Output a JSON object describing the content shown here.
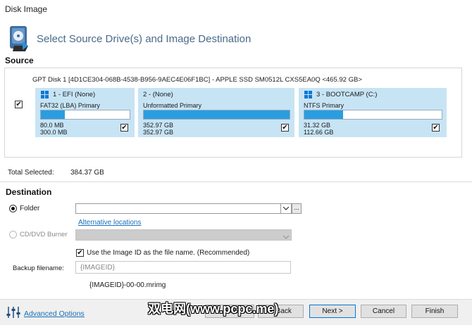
{
  "window": {
    "title": "Disk Image"
  },
  "header": {
    "title": "Select Source Drive(s) and Image Destination",
    "icon": "disk-image-icon"
  },
  "source": {
    "label": "Source",
    "disk_label": "GPT Disk 1 [4D1CE304-068B-4538-B956-9AEC4E06F1BC] - APPLE SSD SM0512L CXS5EA0Q  <465.92 GB>",
    "disk_checked": true,
    "partitions": [
      {
        "title": "1 - EFI (None)",
        "type": "FAT32 (LBA) Primary",
        "used": "80.0 MB",
        "size": "300.0 MB",
        "fill": 0.27,
        "checked": true,
        "windows_icon": true
      },
      {
        "title": "2 -  (None)",
        "type": "Unformatted Primary",
        "used": "352.97 GB",
        "size": "352.97 GB",
        "fill": 1.0,
        "checked": true,
        "windows_icon": false
      },
      {
        "title": "3 - BOOTCAMP (C:)",
        "type": "NTFS Primary",
        "used": "31.32 GB",
        "size": "112.66 GB",
        "fill": 0.28,
        "checked": true,
        "windows_icon": true
      }
    ]
  },
  "total": {
    "label": "Total Selected:",
    "value": "384.37 GB"
  },
  "destination": {
    "label": "Destination",
    "folder_label": "Folder",
    "folder_value": "",
    "browse_label": "...",
    "alt_locations": "Alternative locations",
    "cd_label": "CD/DVD Burner",
    "use_image_id_label": "Use the Image ID as the file name.  (Recommended)",
    "use_image_id_checked": true,
    "backup_label": "Backup filename:",
    "backup_placeholder": "{IMAGEID}",
    "filename_preview": "{IMAGEID}-00-00.mrimg"
  },
  "footer": {
    "advanced_options": "Advanced Options",
    "help": "Help",
    "back": "< Back",
    "next": "Next >",
    "cancel": "Cancel",
    "finish": "Finish"
  },
  "watermark": "双电网(www.pcpc.me)",
  "colors": {
    "partition_bg": "#c7e4f5",
    "bar_fill": "#2a9de0",
    "link": "#1a6fb8"
  }
}
